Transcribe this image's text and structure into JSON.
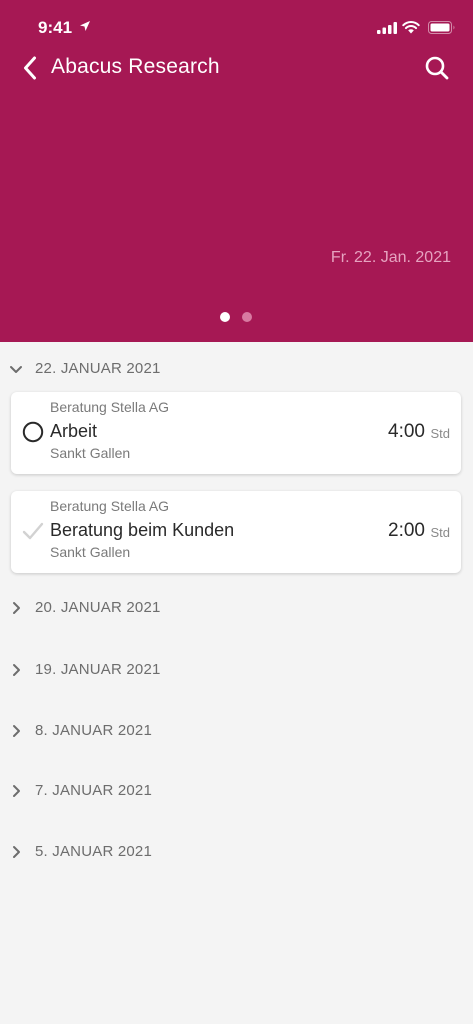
{
  "status_bar": {
    "time": "9:41"
  },
  "nav": {
    "title": "Abacus Research"
  },
  "hero": {
    "date": "Fr. 22. Jan. 2021"
  },
  "sections": [
    {
      "label": "22. JANUAR 2021",
      "expanded": true
    },
    {
      "label": "20. JANUAR 2021",
      "expanded": false
    },
    {
      "label": "19. JANUAR 2021",
      "expanded": false
    },
    {
      "label": "8. JANUAR 2021",
      "expanded": false
    },
    {
      "label": "7. JANUAR 2021",
      "expanded": false
    },
    {
      "label": "5. JANUAR 2021",
      "expanded": false
    }
  ],
  "entries": [
    {
      "company": "Beratung Stella AG",
      "title": "Arbeit",
      "place": "Sankt Gallen",
      "hours": "4:00",
      "unit": "Std",
      "status": "open"
    },
    {
      "company": "Beratung Stella AG",
      "title": "Beratung beim Kunden",
      "place": "Sankt Gallen",
      "hours": "2:00",
      "unit": "Std",
      "status": "done"
    }
  ],
  "colors": {
    "brand": "#a61854",
    "background": "#f4f4f4"
  }
}
